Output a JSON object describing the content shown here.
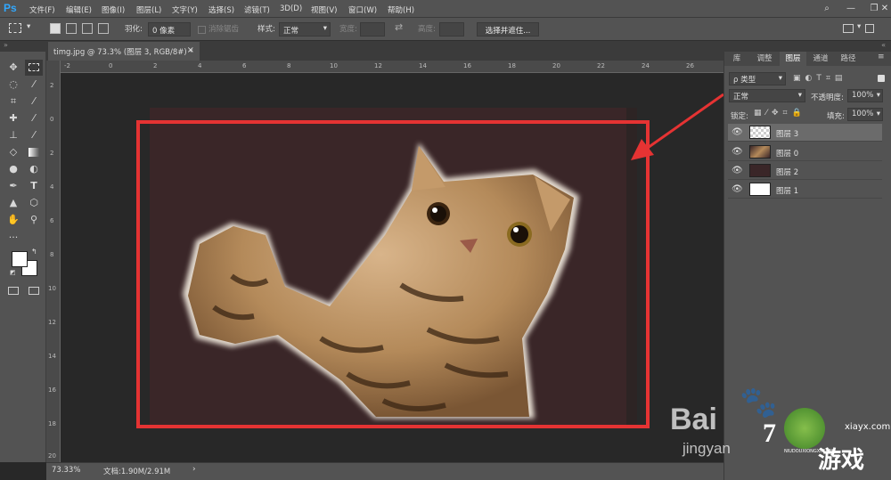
{
  "app": {
    "logo": "Ps"
  },
  "menu": [
    "文件(F)",
    "编辑(E)",
    "图像(I)",
    "图层(L)",
    "文字(Y)",
    "选择(S)",
    "滤镜(T)",
    "3D(D)",
    "视图(V)",
    "窗口(W)",
    "帮助(H)"
  ],
  "options": {
    "feather_label": "羽化:",
    "feather_value": "0 像素",
    "antialias_label": "消除锯齿",
    "style_label": "样式:",
    "style_value": "正常",
    "width_label": "宽度:",
    "height_label": "高度:",
    "select_mask_button": "选择并遮住..."
  },
  "document": {
    "tab_title": "timg.jpg @ 73.3% (图层 3, RGB/8#) *",
    "close": "×",
    "zoom": "73.33%",
    "doc_info": "文档:1.90M/2.91M",
    "canvas_color": "#3a2628"
  },
  "ruler_top": [
    "-2",
    "0",
    "2",
    "4",
    "6",
    "8",
    "10",
    "12",
    "14",
    "16",
    "18",
    "20",
    "22",
    "24",
    "26"
  ],
  "ruler_left": [
    "2",
    "0",
    "2",
    "4",
    "6",
    "8",
    "10",
    "12",
    "14",
    "16",
    "18",
    "20"
  ],
  "panels": {
    "tabs": [
      "库",
      "调整",
      "图层",
      "通道",
      "路径"
    ],
    "active_tab": "图层",
    "kind_filter": "ρ 类型",
    "blend_mode": "正常",
    "opacity_label": "不透明度:",
    "opacity_value": "100%",
    "lock_label": "锁定:",
    "fill_label": "填充:",
    "fill_value": "100%",
    "layers": [
      {
        "name": "图层 3",
        "selected": true,
        "thumb": "transparent"
      },
      {
        "name": "图层 0",
        "selected": false,
        "thumb": "cat"
      },
      {
        "name": "图层 2",
        "selected": false,
        "thumb": "#3a2628"
      },
      {
        "name": "图层 1",
        "selected": false,
        "thumb": "#ffffff"
      }
    ]
  },
  "watermark": {
    "baidu": "Bai",
    "jingyan": "jingyan",
    "site": "xiayx.com",
    "game_text": "游戏",
    "pinyin": "NIUDOUXIONGXI.COM"
  }
}
